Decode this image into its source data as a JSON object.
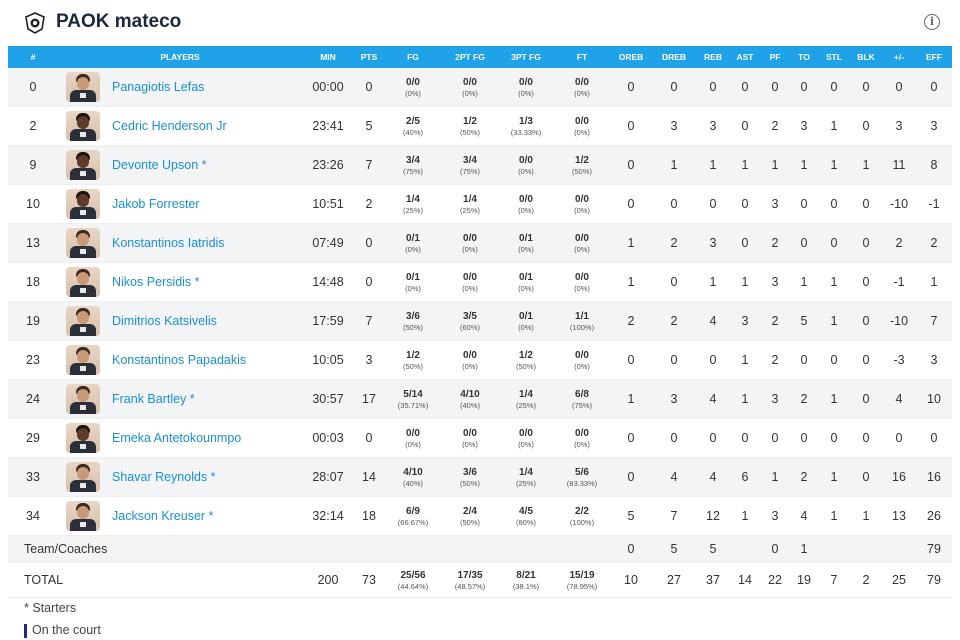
{
  "team": {
    "name": "PAOK mateco"
  },
  "columns": [
    "#",
    "PLAYERS",
    "MIN",
    "PTS",
    "FG",
    "2PT FG",
    "3PT FG",
    "FT",
    "OREB",
    "DREB",
    "REB",
    "AST",
    "PF",
    "TO",
    "STL",
    "BLK",
    "+/-",
    "EFF"
  ],
  "players": [
    {
      "no": "0",
      "name": "Panagiotis Lefas",
      "min": "00:00",
      "pts": "0",
      "fg": "0/0",
      "fgp": "(0%)",
      "fg2": "0/0",
      "fg2p": "(0%)",
      "fg3": "0/0",
      "fg3p": "(0%)",
      "ft": "0/0",
      "ftp": "(0%)",
      "oreb": "0",
      "dreb": "0",
      "reb": "0",
      "ast": "0",
      "pf": "0",
      "to": "0",
      "stl": "0",
      "blk": "0",
      "pm": "0",
      "eff": "0",
      "on_court": false,
      "skin": "light"
    },
    {
      "no": "2",
      "name": "Cedric Henderson Jr",
      "min": "23:41",
      "pts": "5",
      "fg": "2/5",
      "fgp": "(40%)",
      "fg2": "1/2",
      "fg2p": "(50%)",
      "fg3": "1/3",
      "fg3p": "(33.33%)",
      "ft": "0/0",
      "ftp": "(0%)",
      "oreb": "0",
      "dreb": "3",
      "reb": "3",
      "ast": "0",
      "pf": "2",
      "to": "3",
      "stl": "1",
      "blk": "0",
      "pm": "3",
      "eff": "3",
      "on_court": true,
      "skin": "dark"
    },
    {
      "no": "9",
      "name": "Devonte Upson *",
      "min": "23:26",
      "pts": "7",
      "fg": "3/4",
      "fgp": "(75%)",
      "fg2": "3/4",
      "fg2p": "(75%)",
      "fg3": "0/0",
      "fg3p": "(0%)",
      "ft": "1/2",
      "ftp": "(50%)",
      "oreb": "0",
      "dreb": "1",
      "reb": "1",
      "ast": "1",
      "pf": "1",
      "to": "1",
      "stl": "1",
      "blk": "1",
      "pm": "11",
      "eff": "8",
      "on_court": false,
      "skin": "dark"
    },
    {
      "no": "10",
      "name": "Jakob Forrester",
      "min": "10:51",
      "pts": "2",
      "fg": "1/4",
      "fgp": "(25%)",
      "fg2": "1/4",
      "fg2p": "(25%)",
      "fg3": "0/0",
      "fg3p": "(0%)",
      "ft": "0/0",
      "ftp": "(0%)",
      "oreb": "0",
      "dreb": "0",
      "reb": "0",
      "ast": "0",
      "pf": "3",
      "to": "0",
      "stl": "0",
      "blk": "0",
      "pm": "-10",
      "eff": "-1",
      "on_court": false,
      "skin": "dark"
    },
    {
      "no": "13",
      "name": "Konstantinos Iatridis",
      "min": "07:49",
      "pts": "0",
      "fg": "0/1",
      "fgp": "(0%)",
      "fg2": "0/0",
      "fg2p": "(0%)",
      "fg3": "0/1",
      "fg3p": "(0%)",
      "ft": "0/0",
      "ftp": "(0%)",
      "oreb": "1",
      "dreb": "2",
      "reb": "3",
      "ast": "0",
      "pf": "2",
      "to": "0",
      "stl": "0",
      "blk": "0",
      "pm": "2",
      "eff": "2",
      "on_court": false,
      "skin": "light"
    },
    {
      "no": "18",
      "name": "Nikos Persidis *",
      "min": "14:48",
      "pts": "0",
      "fg": "0/1",
      "fgp": "(0%)",
      "fg2": "0/0",
      "fg2p": "(0%)",
      "fg3": "0/1",
      "fg3p": "(0%)",
      "ft": "0/0",
      "ftp": "(0%)",
      "oreb": "1",
      "dreb": "0",
      "reb": "1",
      "ast": "1",
      "pf": "3",
      "to": "1",
      "stl": "1",
      "blk": "0",
      "pm": "-1",
      "eff": "1",
      "on_court": false,
      "skin": "light"
    },
    {
      "no": "19",
      "name": "Dimitrios Katsivelis",
      "min": "17:59",
      "pts": "7",
      "fg": "3/6",
      "fgp": "(50%)",
      "fg2": "3/5",
      "fg2p": "(60%)",
      "fg3": "0/1",
      "fg3p": "(0%)",
      "ft": "1/1",
      "ftp": "(100%)",
      "oreb": "2",
      "dreb": "2",
      "reb": "4",
      "ast": "3",
      "pf": "2",
      "to": "5",
      "stl": "1",
      "blk": "0",
      "pm": "-10",
      "eff": "7",
      "on_court": false,
      "skin": "light"
    },
    {
      "no": "23",
      "name": "Konstantinos Papadakis",
      "min": "10:05",
      "pts": "3",
      "fg": "1/2",
      "fgp": "(50%)",
      "fg2": "0/0",
      "fg2p": "(0%)",
      "fg3": "1/2",
      "fg3p": "(50%)",
      "ft": "0/0",
      "ftp": "(0%)",
      "oreb": "0",
      "dreb": "0",
      "reb": "0",
      "ast": "1",
      "pf": "2",
      "to": "0",
      "stl": "0",
      "blk": "0",
      "pm": "-3",
      "eff": "3",
      "on_court": true,
      "skin": "light"
    },
    {
      "no": "24",
      "name": "Frank Bartley *",
      "min": "30:57",
      "pts": "17",
      "fg": "5/14",
      "fgp": "(35.71%)",
      "fg2": "4/10",
      "fg2p": "(40%)",
      "fg3": "1/4",
      "fg3p": "(25%)",
      "ft": "6/8",
      "ftp": "(75%)",
      "oreb": "1",
      "dreb": "3",
      "reb": "4",
      "ast": "1",
      "pf": "3",
      "to": "2",
      "stl": "1",
      "blk": "0",
      "pm": "4",
      "eff": "10",
      "on_court": true,
      "skin": "light"
    },
    {
      "no": "29",
      "name": "Emeka Antetokounmpo",
      "min": "00:03",
      "pts": "0",
      "fg": "0/0",
      "fgp": "(0%)",
      "fg2": "0/0",
      "fg2p": "(0%)",
      "fg3": "0/0",
      "fg3p": "(0%)",
      "ft": "0/0",
      "ftp": "(0%)",
      "oreb": "0",
      "dreb": "0",
      "reb": "0",
      "ast": "0",
      "pf": "0",
      "to": "0",
      "stl": "0",
      "blk": "0",
      "pm": "0",
      "eff": "0",
      "on_court": false,
      "skin": "dark"
    },
    {
      "no": "33",
      "name": "Shavar Reynolds *",
      "min": "28:07",
      "pts": "14",
      "fg": "4/10",
      "fgp": "(40%)",
      "fg2": "3/6",
      "fg2p": "(50%)",
      "fg3": "1/4",
      "fg3p": "(25%)",
      "ft": "5/6",
      "ftp": "(83.33%)",
      "oreb": "0",
      "dreb": "4",
      "reb": "4",
      "ast": "6",
      "pf": "1",
      "to": "2",
      "stl": "1",
      "blk": "0",
      "pm": "16",
      "eff": "16",
      "on_court": true,
      "skin": "light"
    },
    {
      "no": "34",
      "name": "Jackson Kreuser *",
      "min": "32:14",
      "pts": "18",
      "fg": "6/9",
      "fgp": "(66.67%)",
      "fg2": "2/4",
      "fg2p": "(50%)",
      "fg3": "4/5",
      "fg3p": "(80%)",
      "ft": "2/2",
      "ftp": "(100%)",
      "oreb": "5",
      "dreb": "7",
      "reb": "12",
      "ast": "1",
      "pf": "3",
      "to": "4",
      "stl": "1",
      "blk": "1",
      "pm": "13",
      "eff": "26",
      "on_court": true,
      "skin": "light"
    }
  ],
  "team_row": {
    "label": "Team/Coaches",
    "oreb": "0",
    "dreb": "5",
    "reb": "5",
    "ast": "",
    "pf": "0",
    "to": "1",
    "stl": "",
    "blk": "",
    "pm": "",
    "eff": "79"
  },
  "total_row": {
    "label": "TOTAL",
    "min": "200",
    "pts": "73",
    "fg": "25/56",
    "fgp": "(44.64%)",
    "fg2": "17/35",
    "fg2p": "(48.57%)",
    "fg3": "8/21",
    "fg3p": "(38.1%)",
    "ft": "15/19",
    "ftp": "(78.95%)",
    "oreb": "10",
    "dreb": "27",
    "reb": "37",
    "ast": "14",
    "pf": "22",
    "to": "19",
    "stl": "7",
    "blk": "2",
    "pm": "25",
    "eff": "79"
  },
  "legend": {
    "starters": "* Starters",
    "on_court": "On the court"
  },
  "icons": {
    "logo": "team-logo-icon",
    "info": "info-icon"
  },
  "colors": {
    "header_bg": "#1fa2e8",
    "player_link": "#1a8fd6",
    "on_court_bar": "#1f2a8a"
  }
}
